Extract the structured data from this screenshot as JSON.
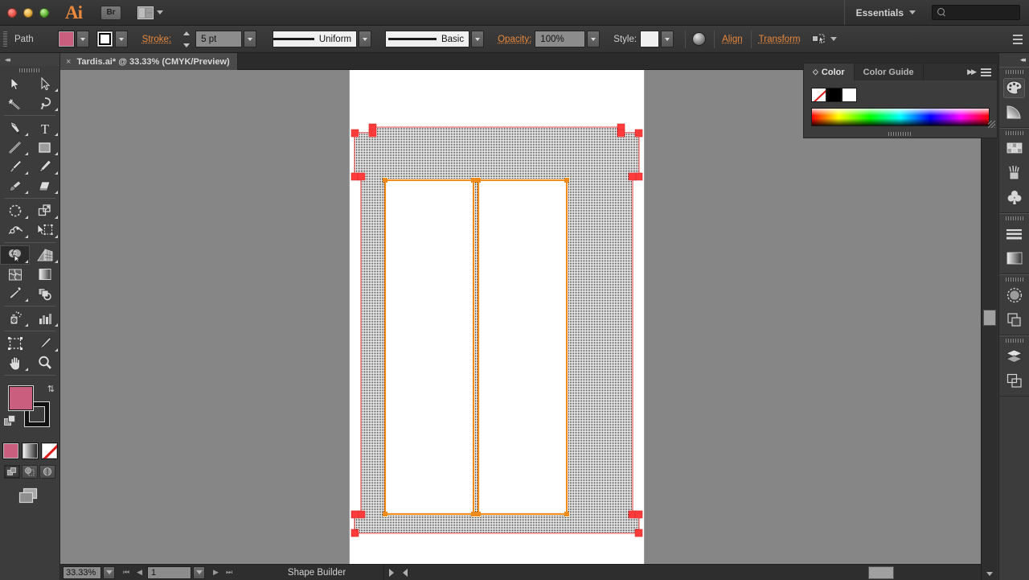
{
  "app": {
    "logo": "Ai",
    "bridge_label": "Br",
    "workspace": "Essentials",
    "search_placeholder": ""
  },
  "control_bar": {
    "object_label": "Path",
    "fill_color": "#c95e7e",
    "stroke_swatch": "white-with-black-square",
    "stroke_label": "Stroke:",
    "stroke_weight": "5 pt",
    "variable_width_profile": "Uniform",
    "brush_definition": "Basic",
    "opacity_label": "Opacity:",
    "opacity_value": "100%",
    "style_label": "Style:",
    "align_label": "Align",
    "transform_label": "Transform",
    "accent_color": "#e8883c"
  },
  "document": {
    "tab_title": "Tardis.ai* @ 33.33% (CMYK/Preview)",
    "close_glyph": "×"
  },
  "toolbox": {
    "collapse_glyph": "◂◂",
    "tools": [
      {
        "name": "selection-tool",
        "label": "Selection"
      },
      {
        "name": "direct-selection-tool",
        "label": "Direct Selection"
      },
      {
        "name": "magic-wand-tool",
        "label": "Magic Wand"
      },
      {
        "name": "lasso-tool",
        "label": "Lasso"
      },
      {
        "name": "pen-tool",
        "label": "Pen"
      },
      {
        "name": "type-tool",
        "label": "Type"
      },
      {
        "name": "line-segment-tool",
        "label": "Line Segment"
      },
      {
        "name": "rectangle-tool",
        "label": "Rectangle"
      },
      {
        "name": "paintbrush-tool",
        "label": "Paintbrush"
      },
      {
        "name": "pencil-tool",
        "label": "Pencil"
      },
      {
        "name": "blob-brush-tool",
        "label": "Blob Brush"
      },
      {
        "name": "eraser-tool",
        "label": "Eraser"
      },
      {
        "name": "rotate-tool",
        "label": "Rotate"
      },
      {
        "name": "scale-tool",
        "label": "Scale"
      },
      {
        "name": "width-tool",
        "label": "Width"
      },
      {
        "name": "free-transform-tool",
        "label": "Free Transform"
      },
      {
        "name": "shape-builder-tool",
        "label": "Shape Builder"
      },
      {
        "name": "perspective-grid-tool",
        "label": "Perspective Grid"
      },
      {
        "name": "mesh-tool",
        "label": "Mesh"
      },
      {
        "name": "gradient-tool",
        "label": "Gradient"
      },
      {
        "name": "eyedropper-tool",
        "label": "Eyedropper"
      },
      {
        "name": "blend-tool",
        "label": "Blend"
      },
      {
        "name": "symbol-sprayer-tool",
        "label": "Symbol Sprayer"
      },
      {
        "name": "column-graph-tool",
        "label": "Column Graph"
      },
      {
        "name": "artboard-tool",
        "label": "Artboard"
      },
      {
        "name": "slice-tool",
        "label": "Slice"
      },
      {
        "name": "hand-tool",
        "label": "Hand"
      },
      {
        "name": "zoom-tool",
        "label": "Zoom"
      }
    ],
    "active_tool": "shape-builder-tool",
    "fill_color": "#c95e7e",
    "stroke_color": "#111111",
    "color_modes": [
      "color",
      "gradient",
      "none"
    ],
    "draw_modes": [
      "draw-normal",
      "draw-behind",
      "draw-inside"
    ],
    "active_draw_mode": "draw-normal",
    "screen_mode": "change-screen-mode"
  },
  "color_panel": {
    "tabs": [
      {
        "label": "Color",
        "active": true
      },
      {
        "label": "Color Guide",
        "active": false
      }
    ],
    "swatches": [
      "none",
      "black",
      "white"
    ],
    "spectrum": "cmyk-spectrum-ramp"
  },
  "dock": {
    "collapse_glyph": "◂◂",
    "groups": [
      {
        "items": [
          {
            "name": "color-panel-icon",
            "label": "Color",
            "active": true
          },
          {
            "name": "color-guide-panel-icon",
            "label": "Color Guide",
            "active": false
          }
        ]
      },
      {
        "items": [
          {
            "name": "swatches-panel-icon",
            "label": "Swatches",
            "active": false
          },
          {
            "name": "brushes-panel-icon",
            "label": "Brushes",
            "active": false
          },
          {
            "name": "symbols-panel-icon",
            "label": "Symbols",
            "active": false
          }
        ]
      },
      {
        "items": [
          {
            "name": "stroke-panel-icon",
            "label": "Stroke",
            "active": false
          },
          {
            "name": "gradient-panel-icon",
            "label": "Gradient",
            "active": false
          }
        ]
      },
      {
        "items": [
          {
            "name": "transparency-panel-icon",
            "label": "Transparency",
            "active": false
          },
          {
            "name": "appearance-panel-icon",
            "label": "Appearance",
            "active": false
          }
        ]
      },
      {
        "items": [
          {
            "name": "layers-panel-icon",
            "label": "Layers",
            "active": false
          },
          {
            "name": "artboards-panel-icon",
            "label": "Artboards",
            "active": false
          }
        ]
      }
    ]
  },
  "status_bar": {
    "zoom_level": "33.33%",
    "page_number": "1",
    "status_text": "Shape Builder",
    "first_glyph": "⏮",
    "prev_glyph": "◀",
    "next_glyph": "▶",
    "last_glyph": "⏭"
  },
  "artwork": {
    "name": "tardis-police-box-drawing",
    "fill_pattern": "black-stipple-dither",
    "selection_anchor_color": "#ff3b3b",
    "inner_path_color": "#f08c1e",
    "outline_color": "#e84a4a"
  }
}
